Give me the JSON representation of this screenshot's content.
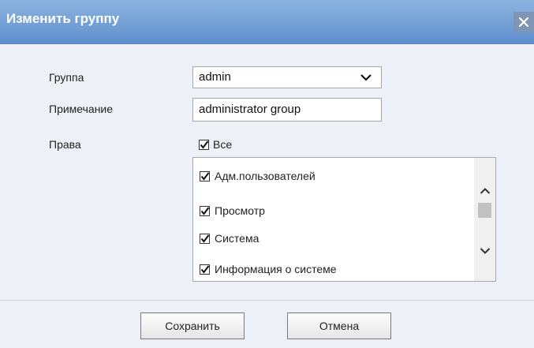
{
  "dialog": {
    "title": "Изменить группу",
    "close_icon": "close-icon"
  },
  "form": {
    "group_label": "Группа",
    "group_value": "admin",
    "note_label": "Примечание",
    "note_value": "administrator group",
    "rights_label": "Права",
    "all_label": "Все",
    "all_checked": true
  },
  "permissions": [
    {
      "label": "Адм.пользователей",
      "checked": true
    },
    {
      "label": "Просмотр",
      "checked": true
    },
    {
      "label": "Система",
      "checked": true
    },
    {
      "label": "Информация о системе",
      "checked": true
    }
  ],
  "buttons": {
    "save_label": "Сохранить",
    "cancel_label": "Отмена"
  }
}
